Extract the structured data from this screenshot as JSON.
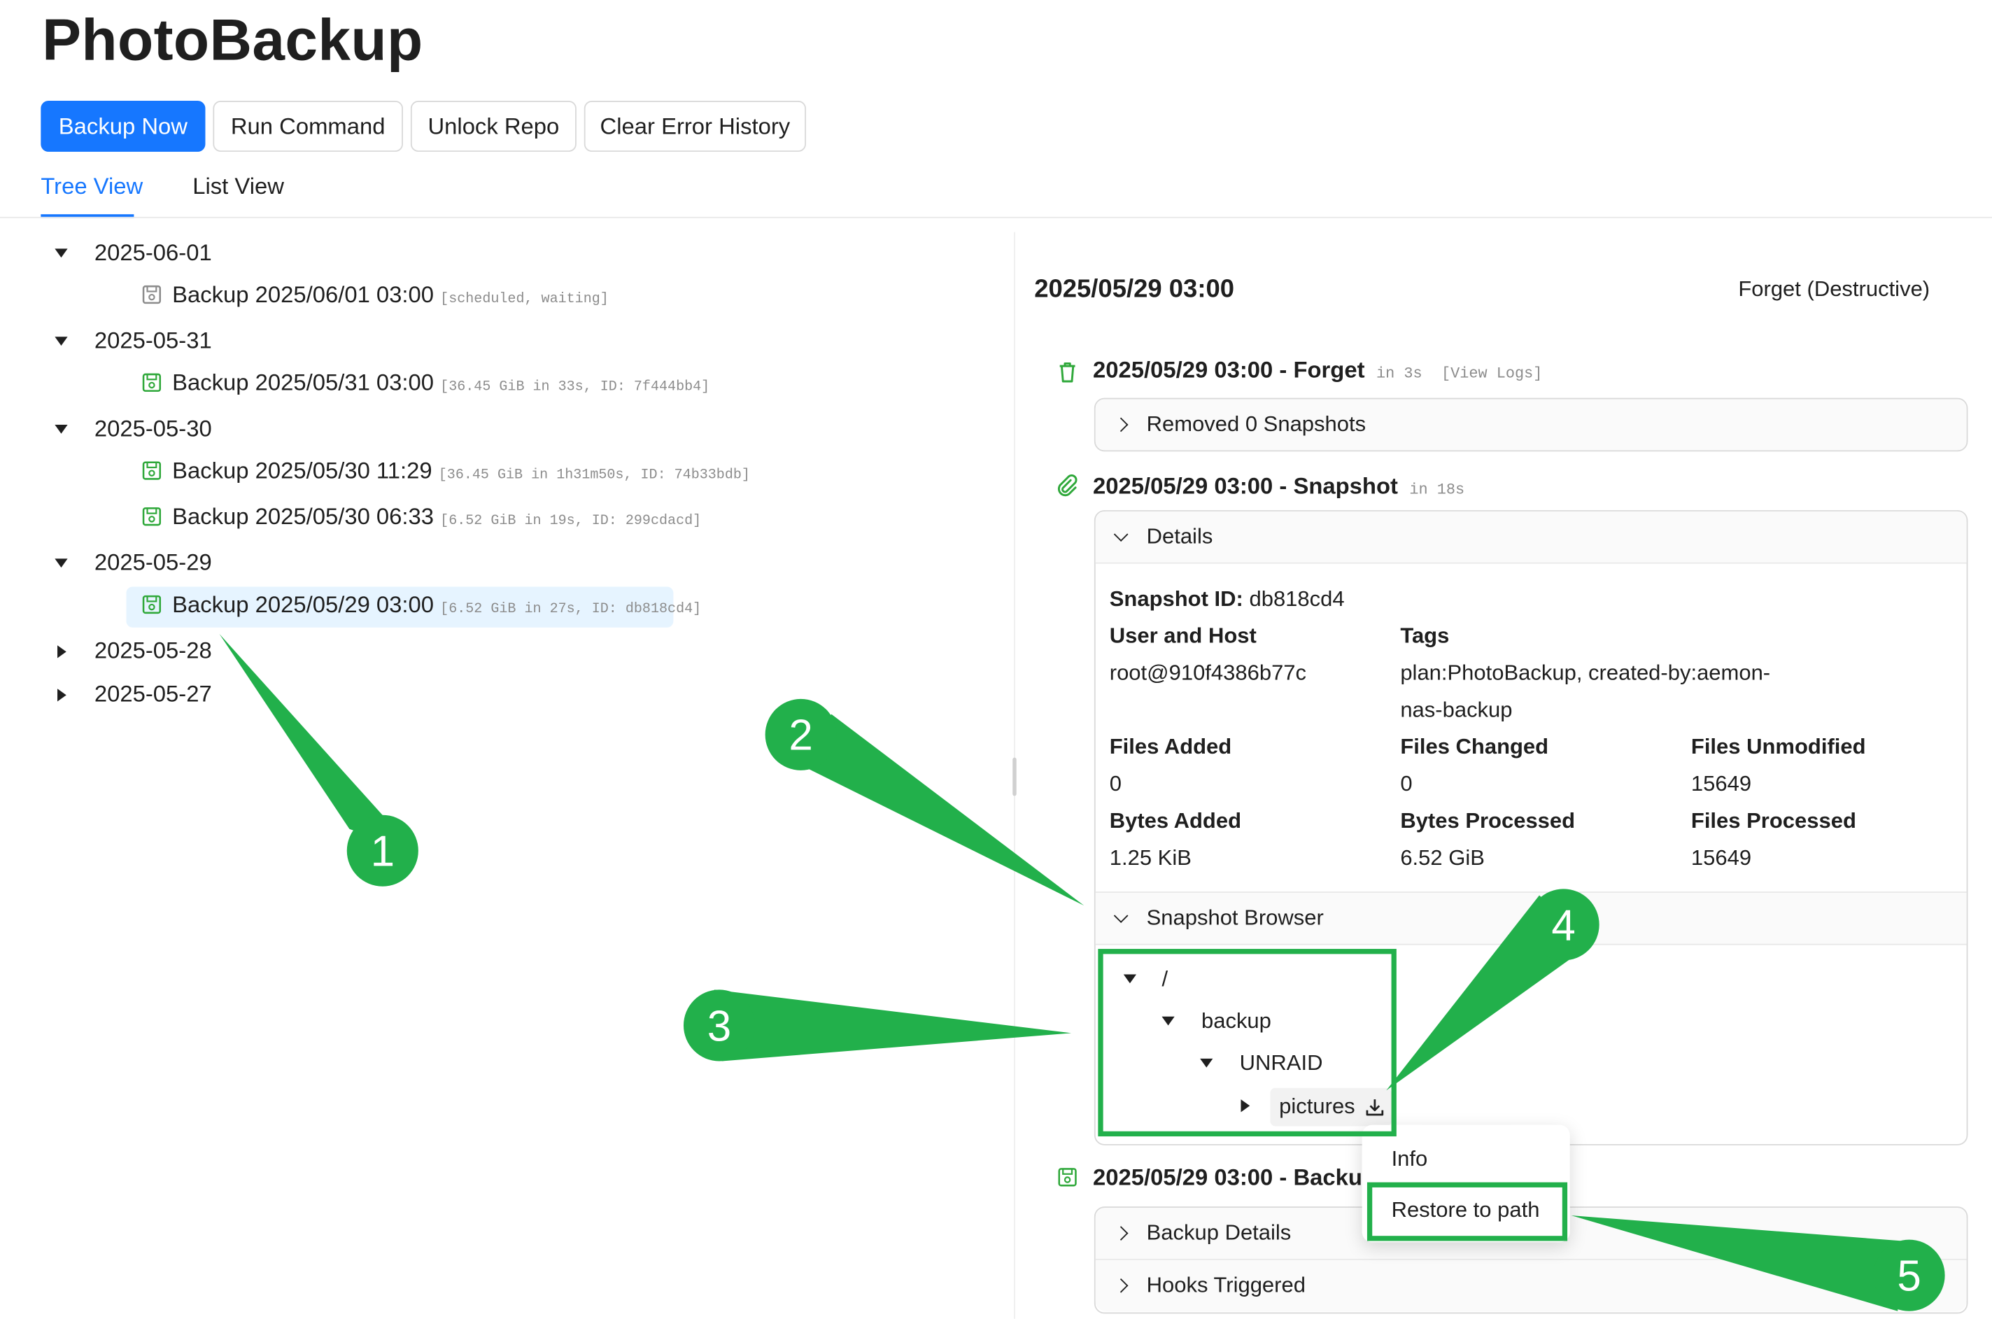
{
  "app": {
    "title": "PhotoBackup"
  },
  "toolbar": {
    "backup_now": "Backup Now",
    "run_command": "Run Command",
    "unlock_repo": "Unlock Repo",
    "clear_error_history": "Clear Error History"
  },
  "tabs": {
    "tree_view": "Tree View",
    "list_view": "List View",
    "active": "Tree View"
  },
  "tree": {
    "days": [
      {
        "date": "2025-06-01",
        "expanded": true,
        "backups": [
          {
            "label": "Backup 2025/06/01 03:00",
            "meta": "[scheduled, waiting]",
            "status": "pending"
          }
        ]
      },
      {
        "date": "2025-05-31",
        "expanded": true,
        "backups": [
          {
            "label": "Backup 2025/05/31 03:00",
            "meta": "[36.45 GiB in 33s, ID: 7f444bb4]",
            "status": "ok"
          }
        ]
      },
      {
        "date": "2025-05-30",
        "expanded": true,
        "backups": [
          {
            "label": "Backup 2025/05/30 11:29",
            "meta": "[36.45 GiB in 1h31m50s, ID: 74b33bdb]",
            "status": "ok"
          },
          {
            "label": "Backup 2025/05/30 06:33",
            "meta": "[6.52 GiB in 19s, ID: 299cdacd]",
            "status": "ok"
          }
        ]
      },
      {
        "date": "2025-05-29",
        "expanded": true,
        "backups": [
          {
            "label": "Backup 2025/05/29 03:00",
            "meta": "[6.52 GiB in 27s, ID: db818cd4]",
            "status": "ok",
            "selected": true
          }
        ]
      },
      {
        "date": "2025-05-28",
        "expanded": false
      },
      {
        "date": "2025-05-27",
        "expanded": false
      }
    ]
  },
  "detail": {
    "title": "2025/05/29 03:00",
    "forget_action": "Forget (Destructive)",
    "forget_op": {
      "title": "2025/05/29 03:00 - Forget",
      "duration": "in 3s",
      "view_logs": "[View Logs]",
      "collapse_label": "Removed 0 Snapshots"
    },
    "snapshot_op": {
      "title": "2025/05/29 03:00 - Snapshot",
      "duration": "in 18s",
      "details_label": "Details",
      "snapshot_id_label": "Snapshot ID:",
      "snapshot_id": "db818cd4",
      "user_host_label": "User and Host",
      "user_host": "root@910f4386b77c",
      "tags_label": "Tags",
      "tags_line1": "plan:PhotoBackup, created-by:aemon-",
      "tags_line2": "nas-backup",
      "files_added_label": "Files Added",
      "files_added": "0",
      "files_changed_label": "Files Changed",
      "files_changed": "0",
      "files_unmodified_label": "Files Unmodified",
      "files_unmodified": "15649",
      "bytes_added_label": "Bytes Added",
      "bytes_added": "1.25 KiB",
      "bytes_processed_label": "Bytes Processed",
      "bytes_processed": "6.52 GiB",
      "files_processed_label": "Files Processed",
      "files_processed": "15649",
      "browser_label": "Snapshot Browser",
      "browser_nodes": {
        "root": "/",
        "backup": "backup",
        "unraid": "UNRAID",
        "pictures": "pictures"
      }
    },
    "backup_op": {
      "title_visible": "2025/05/29 03:00 - Backu",
      "backup_details": "Backup Details",
      "hooks_triggered": "Hooks Triggered"
    }
  },
  "context_menu": {
    "info": "Info",
    "restore_to_path": "Restore to path"
  },
  "callouts": [
    "1",
    "2",
    "3",
    "4",
    "5"
  ],
  "colors": {
    "accent": "#1677ff",
    "callout_green": "#22b04b",
    "success_icon": "#2fa83a",
    "selected_bg": "#e6f4ff"
  }
}
